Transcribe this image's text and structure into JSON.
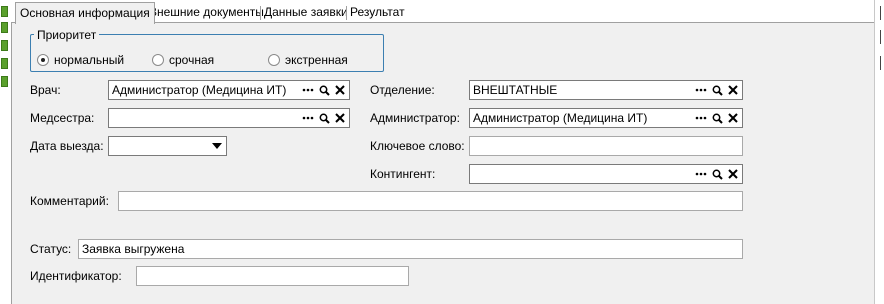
{
  "tabs": [
    {
      "label": "Основная информация",
      "active": true
    },
    {
      "label": "Внешние документы",
      "active": false
    },
    {
      "label": "Данные заявки",
      "active": false
    },
    {
      "label": "Результат",
      "active": false
    }
  ],
  "priority": {
    "title": "Приоритет",
    "options": [
      "нормальный",
      "срочная",
      "экстренная"
    ],
    "selected": "нормальный"
  },
  "form": {
    "doctor_label": "Врач:",
    "doctor_value": "Администратор (Медицина ИТ)",
    "nurse_label": "Медсестра:",
    "nurse_value": "",
    "date_label": "Дата выезда:",
    "date_value": "",
    "department_label": "Отделение:",
    "department_value": "ВНЕШТАТНЫЕ",
    "admin_label": "Администратор:",
    "admin_value": "Администратор (Медицина ИТ)",
    "keyword_label": "Ключевое слово:",
    "keyword_value": "",
    "contingent_label": "Контингент:",
    "contingent_value": "",
    "comment_label": "Комментарий:",
    "comment_value": "",
    "status_label": "Статус:",
    "status_value": "Заявка выгружена",
    "identifier_label": "Идентификатор:",
    "identifier_value": ""
  },
  "icons": {
    "ellipsis": "ellipsis-icon",
    "search": "search-icon",
    "clear": "close-icon",
    "dropdown": "chevron-down-icon"
  },
  "colors": {
    "panel_bg": "#f0f0f0",
    "group_border": "#3c7fb1",
    "side_marker": "#5aa02c"
  }
}
